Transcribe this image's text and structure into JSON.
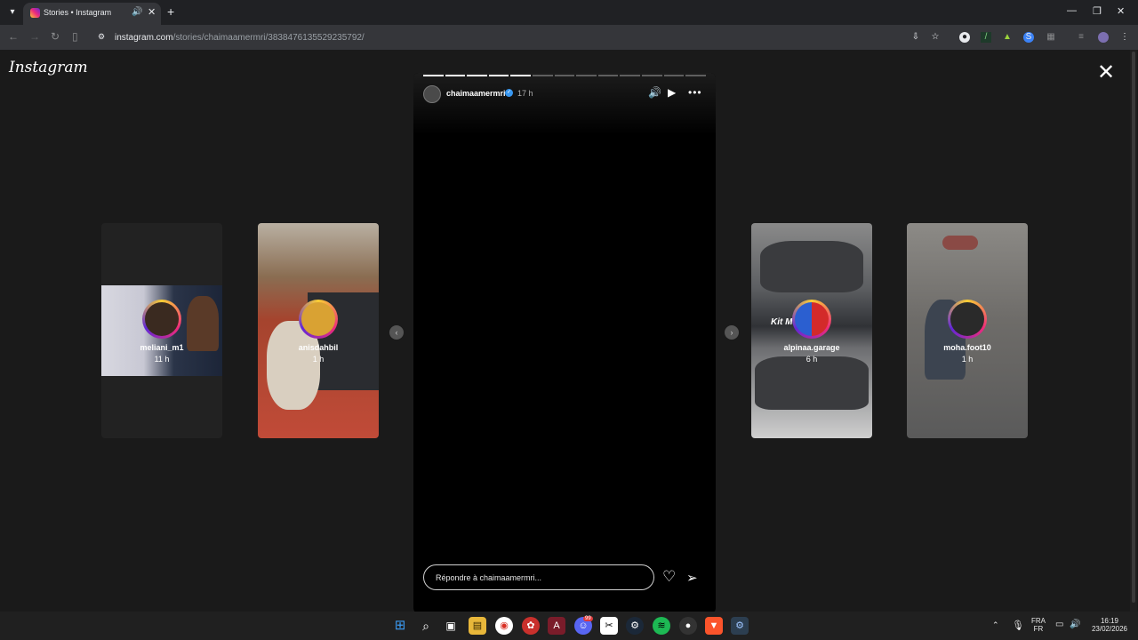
{
  "browser": {
    "tab_title": "Stories • Instagram",
    "url_host": "instagram.com",
    "url_path": "/stories/chaimaamermri/3838476135529235792/"
  },
  "page": {
    "logo": "Instagram",
    "close_icon": "close-icon"
  },
  "story": {
    "username": "chaimaamermri",
    "time": "17 h",
    "progress_total": 13,
    "progress_done": 5,
    "reply_placeholder": "Répondre à chaimaamermri..."
  },
  "previews": [
    {
      "username": "meliani_m1",
      "time": "11 h"
    },
    {
      "username": "anisdahbil",
      "time": "1 h"
    },
    {
      "username": "alpinaa.garage",
      "time": "6 h",
      "overlay_text": "Kit M"
    },
    {
      "username": "moha.foot10",
      "time": "1 h"
    }
  ],
  "taskbar": {
    "lang_top": "FRA",
    "lang_bottom": "FR",
    "clock_time": "16:19",
    "clock_date": "23/02/2026",
    "discord_badge": "99"
  },
  "colors": {
    "instagram_gradient": [
      "#f9ce34",
      "#ee2a7b",
      "#6228d7"
    ],
    "verified": "#3897f0"
  }
}
